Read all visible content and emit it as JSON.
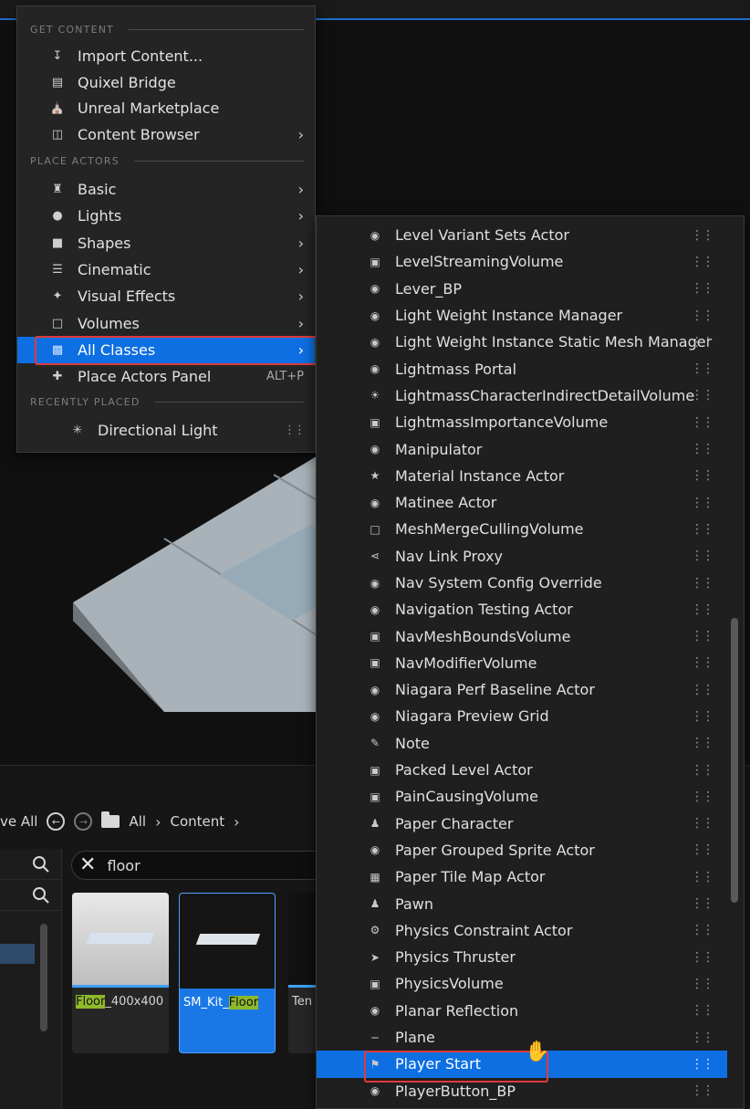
{
  "menu": {
    "sections": {
      "get_content": "GET CONTENT",
      "place_actors": "PLACE ACTORS",
      "recently_placed": "RECENTLY PLACED"
    },
    "items": [
      {
        "label": "Import Content...",
        "icon": "import-icon",
        "arrow": false
      },
      {
        "label": "Quixel Bridge",
        "icon": "bridge-icon",
        "arrow": false
      },
      {
        "label": "Unreal Marketplace",
        "icon": "marketplace-icon",
        "arrow": false
      },
      {
        "label": "Content Browser",
        "icon": "content-browser-icon",
        "arrow": true
      },
      {
        "label": "Basic",
        "icon": "basic-icon",
        "arrow": true
      },
      {
        "label": "Lights",
        "icon": "light-bulb-icon",
        "arrow": true
      },
      {
        "label": "Shapes",
        "icon": "cube-icon",
        "arrow": true
      },
      {
        "label": "Cinematic",
        "icon": "clapper-icon",
        "arrow": true
      },
      {
        "label": "Visual Effects",
        "icon": "sparkle-icon",
        "arrow": true
      },
      {
        "label": "Volumes",
        "icon": "volume-icon",
        "arrow": true
      },
      {
        "label": "All Classes",
        "icon": "classes-icon",
        "arrow": true
      },
      {
        "label": "Place Actors Panel",
        "icon": "place-actors-icon",
        "shortcut": "ALT+P"
      }
    ],
    "recent": {
      "label": "Directional Light",
      "icon": "directional-light-icon"
    }
  },
  "classes": [
    "Level Variant Sets Actor",
    "LevelStreamingVolume",
    "Lever_BP",
    "Light Weight Instance Manager",
    "Light Weight Instance Static Mesh Manager",
    "Lightmass Portal",
    "LightmassCharacterIndirectDetailVolume",
    "LightmassImportanceVolume",
    "Manipulator",
    "Material Instance Actor",
    "Matinee Actor",
    "MeshMergeCullingVolume",
    "Nav Link Proxy",
    "Nav System Config Override",
    "Navigation Testing Actor",
    "NavMeshBoundsVolume",
    "NavModifierVolume",
    "Niagara Perf Baseline Actor",
    "Niagara Preview Grid",
    "Note",
    "Packed Level Actor",
    "PainCausingVolume",
    "Paper Character",
    "Paper Grouped Sprite Actor",
    "Paper Tile Map Actor",
    "Pawn",
    "Physics Constraint Actor",
    "Physics Thruster",
    "PhysicsVolume",
    "Planar Reflection",
    "Plane",
    "Player Start",
    "PlayerButton_BP"
  ],
  "selected_class": "Player Start",
  "content_browser": {
    "save_all": "ve All",
    "path_all": "All",
    "path_content": "Content",
    "search_value": "floor",
    "assets": [
      {
        "prefix": "",
        "highlight": "Floor",
        "suffix": "_400x400"
      },
      {
        "prefix": "SM_Kit_",
        "highlight": "Floor",
        "suffix": ""
      },
      {
        "prefix": "Ten",
        "highlight": "",
        "suffix": ""
      }
    ]
  },
  "colors": {
    "accent": "#0d6fe2",
    "outline": "#e03a3a",
    "highlight": "#8fb82c"
  }
}
